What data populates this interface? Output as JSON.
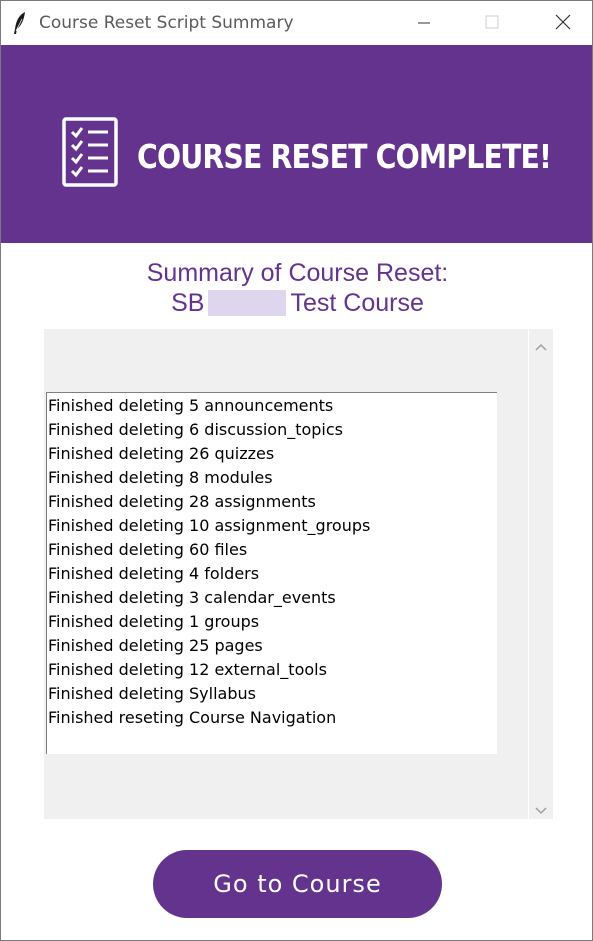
{
  "window": {
    "title": "Course Reset Script Summary",
    "app_icon": "feather-icon",
    "controls": [
      "minimize-icon",
      "maximize-icon",
      "close-icon"
    ]
  },
  "banner": {
    "icon": "checklist-icon",
    "title": "COURSE RESET COMPLETE!",
    "background": "#63338d"
  },
  "summary": {
    "heading_line1": "Summary of Course Reset:",
    "course_prefix": "SB",
    "course_suffix": "Test Course"
  },
  "log": {
    "lines": [
      "Finished deleting 5 announcements",
      "Finished deleting 6 discussion_topics",
      "Finished deleting 26 quizzes",
      "Finished deleting 8 modules",
      "Finished deleting 28 assignments",
      "Finished deleting 10 assignment_groups",
      "Finished deleting 60 files",
      "Finished deleting 4 folders",
      "Finished deleting 3 calendar_events",
      "Finished deleting 1 groups",
      "Finished deleting 25 pages",
      "Finished deleting 12 external_tools",
      "Finished deleting Syllabus",
      "Finished reseting Course Navigation"
    ]
  },
  "actions": {
    "go_to_course": "Go to Course"
  },
  "colors": {
    "accent": "#63338d",
    "panel": "#f0f0f0"
  }
}
